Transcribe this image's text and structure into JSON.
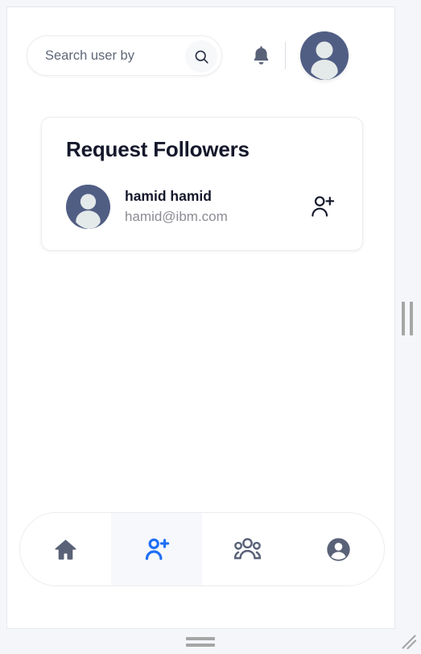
{
  "app": {
    "background_color": "#f5f6fa",
    "surface_color": "#ffffff",
    "accent_color": "#1f6ef4",
    "avatar_color": "#515e84",
    "icon_color": "#5a6278",
    "muted_text_color": "#8c8c94"
  },
  "header": {
    "search": {
      "placeholder": "Search user by",
      "value": "",
      "icon": "search-icon"
    },
    "notifications": {
      "icon": "bell-icon"
    },
    "divider": {
      "name": "header-divider"
    },
    "profile": {
      "icon": "user-avatar-placeholder-icon"
    }
  },
  "card": {
    "title": "Request Followers",
    "followers": [
      {
        "name": "hamid hamid",
        "email": "hamid@ibm.com",
        "avatar_icon": "user-avatar-placeholder-icon",
        "action_icon": "person-add-outline-icon"
      }
    ]
  },
  "bottom_nav": {
    "items": [
      {
        "name": "home",
        "icon": "home-icon",
        "active": false
      },
      {
        "name": "add-follower",
        "icon": "person-add-icon",
        "active": true
      },
      {
        "name": "groups",
        "icon": "people-group-icon",
        "active": false
      },
      {
        "name": "account",
        "icon": "account-circle-icon",
        "active": false
      }
    ]
  },
  "window_controls": {
    "vertical_splitter": "vertical-drag-handle",
    "horizontal_splitter": "horizontal-drag-handle",
    "corner_grip": "resize-grip-icon"
  }
}
